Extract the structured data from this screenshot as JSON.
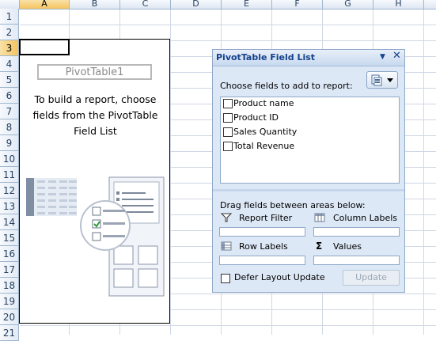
{
  "columns": [
    "A",
    "B",
    "C",
    "D",
    "E",
    "F",
    "G",
    "H"
  ],
  "rows": [
    "1",
    "2",
    "3",
    "4",
    "5",
    "6",
    "7",
    "8",
    "9",
    "10",
    "11",
    "12",
    "13",
    "14",
    "15",
    "16",
    "17",
    "18",
    "19",
    "20",
    "21"
  ],
  "active_column": "A",
  "active_row": "3",
  "pivot": {
    "name": "PivotTable1",
    "instructions": "To build a report, choose fields from the PivotTable Field List"
  },
  "field_list": {
    "title": "PivotTable Field List",
    "choose_label": "Choose fields to add to report:",
    "fields": [
      {
        "label": "Product name",
        "checked": false
      },
      {
        "label": "Product ID",
        "checked": false
      },
      {
        "label": "Sales Quantity",
        "checked": false
      },
      {
        "label": "Total Revenue",
        "checked": false
      }
    ],
    "drag_label": "Drag fields between areas below:",
    "areas": {
      "report_filter": "Report Filter",
      "column_labels": "Column Labels",
      "row_labels": "Row Labels",
      "values": "Values"
    },
    "defer_label": "Defer Layout Update",
    "defer_checked": false,
    "update_label": "Update"
  }
}
